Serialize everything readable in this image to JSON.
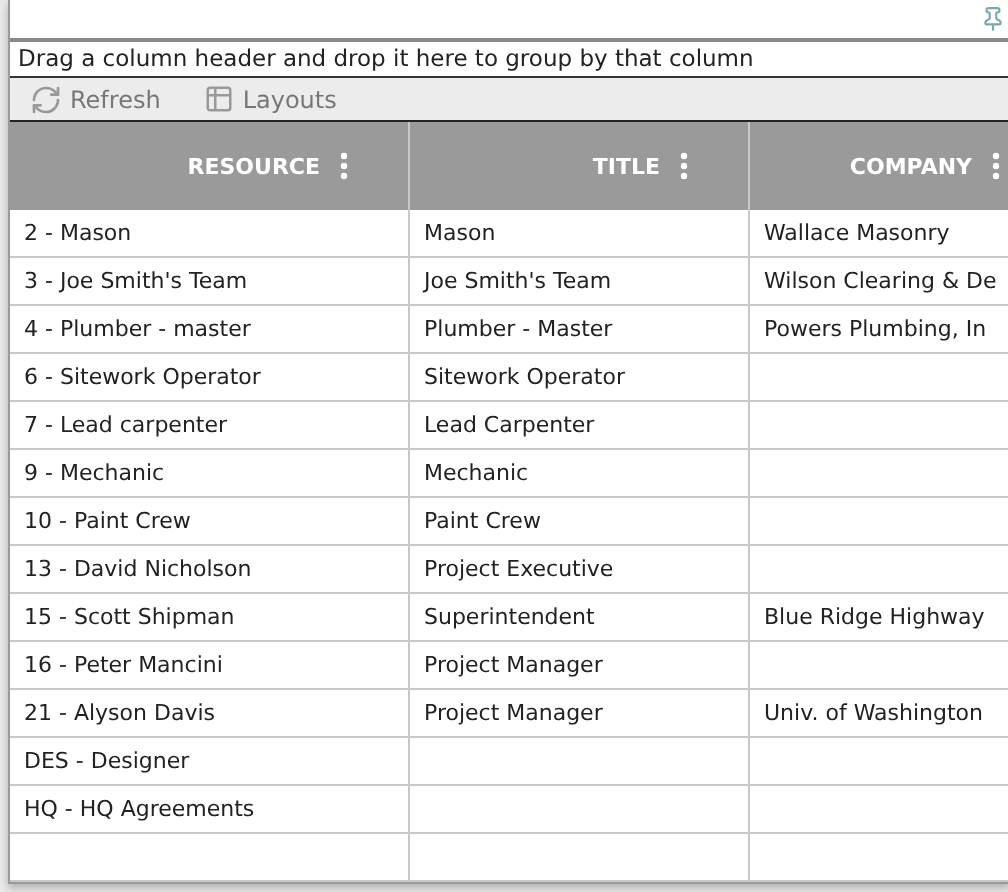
{
  "group_panel": {
    "hint": "Drag a column header and drop it here to group by that column"
  },
  "toolbar": [
    {
      "kind": "refresh",
      "label": "Refresh"
    },
    {
      "kind": "layouts",
      "label": "Layouts"
    }
  ],
  "table": {
    "columns": [
      "RESOURCE",
      "TITLE",
      "COMPANY"
    ],
    "rows": [
      [
        "2 - Mason",
        "Mason",
        "Wallace Masonry"
      ],
      [
        "3 - Joe Smith's Team",
        "Joe Smith's Team",
        "Wilson Clearing & De"
      ],
      [
        "4 - Plumber - master",
        "Plumber - Master",
        "Powers Plumbing, In"
      ],
      [
        "6 - Sitework Operator",
        "Sitework Operator",
        ""
      ],
      [
        "7 - Lead carpenter",
        "Lead Carpenter",
        ""
      ],
      [
        "9 - Mechanic",
        "Mechanic",
        ""
      ],
      [
        "10 - Paint Crew",
        "Paint Crew",
        ""
      ],
      [
        "13 - David Nicholson",
        "Project Executive",
        ""
      ],
      [
        "15 - Scott Shipman",
        "Superintendent",
        "Blue Ridge Highway"
      ],
      [
        "16 - Peter Mancini",
        "Project Manager",
        ""
      ],
      [
        "21 - Alyson Davis",
        "Project Manager",
        "Univ. of Washington"
      ],
      [
        "DES - Designer",
        "",
        ""
      ],
      [
        "HQ - HQ Agreements",
        "",
        ""
      ]
    ]
  }
}
